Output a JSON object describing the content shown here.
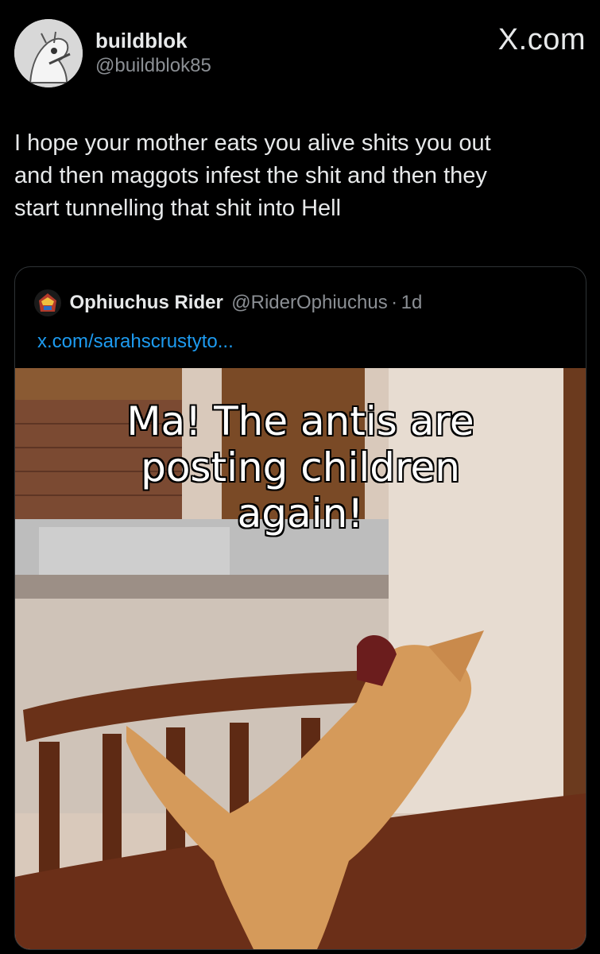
{
  "brand": "X.com",
  "author": {
    "display_name": "buildblok",
    "handle": "@buildblok85"
  },
  "tweet": {
    "lines": [
      "I hope your mother eats you alive shits you out",
      "and then maggots infest the shit and then they",
      "start tunnelling that shit into Hell"
    ]
  },
  "quote": {
    "display_name": "Ophiuchus Rider",
    "handle": "@RiderOphiuchus",
    "separator": "·",
    "time": "1d",
    "link": "x.com/sarahscrustyto...",
    "image_caption": [
      "Ma! The antis are",
      "posting children",
      "again!"
    ]
  }
}
